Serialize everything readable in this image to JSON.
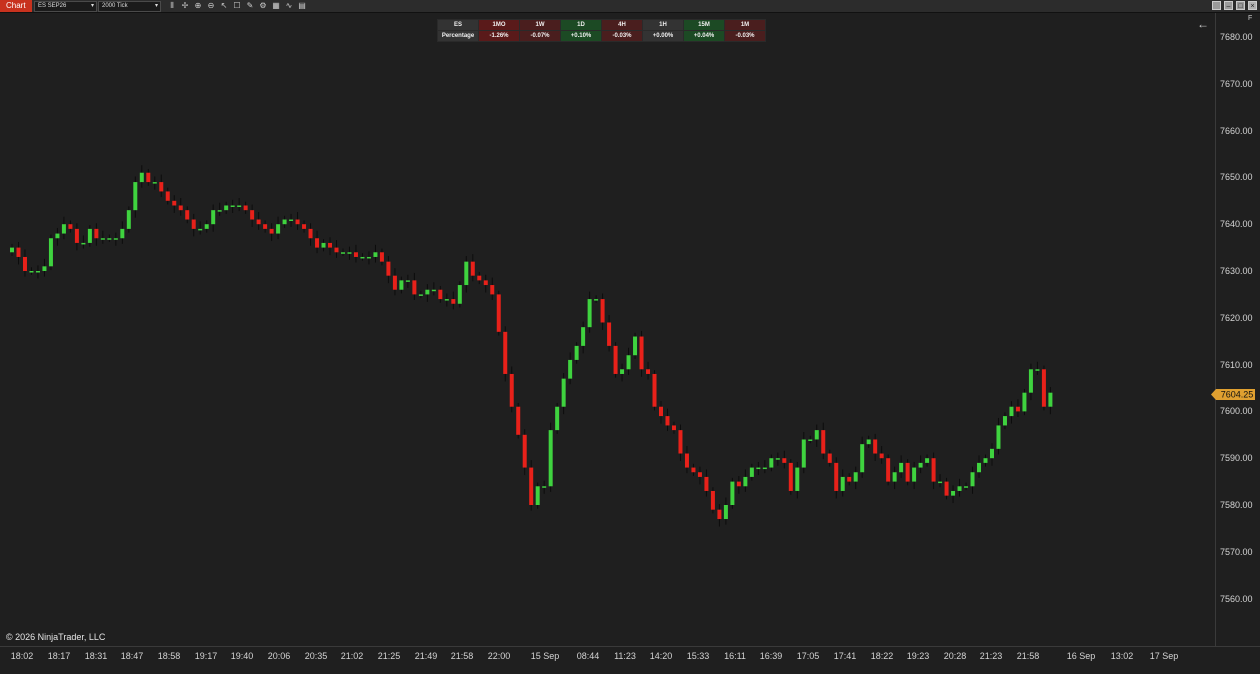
{
  "toolbar": {
    "chart_tab": "Chart",
    "instrument": "ES SEP26",
    "interval": "2000 Tick",
    "icons": [
      "bars-icon",
      "crosshair-icon",
      "zoom-in-icon",
      "zoom-out-icon",
      "pointer-icon",
      "properties-icon",
      "drawing-tools-icon",
      "strategies-icon",
      "data-box-icon",
      "indicators-icon",
      "templates-icon"
    ]
  },
  "performance_table": {
    "symbol": "ES",
    "row_label": "Percentage",
    "columns": [
      {
        "period": "1MO",
        "value": "-1.26%",
        "color": "#5a1a1a"
      },
      {
        "period": "1W",
        "value": "-0.07%",
        "color": "#4a1e1e"
      },
      {
        "period": "1D",
        "value": "+0.10%",
        "color": "#1c4a24"
      },
      {
        "period": "4H",
        "value": "-0.03%",
        "color": "#4a1e1e"
      },
      {
        "period": "1H",
        "value": "+0.00%",
        "color": "#333333"
      },
      {
        "period": "15M",
        "value": "+0.04%",
        "color": "#1c4a24"
      },
      {
        "period": "1M",
        "value": "-0.03%",
        "color": "#4a1e1e"
      }
    ]
  },
  "copyright": "© 2026 NinjaTrader, LLC",
  "axis_menu_label": "F",
  "last_price": "7604.25",
  "colors": {
    "up": "#3fd33f",
    "down": "#e8211a",
    "wick": "#1a1a1a",
    "price_marker": "#e0a030"
  },
  "chart_data": {
    "type": "candlestick",
    "ylim": [
      7555,
      7685
    ],
    "y_ticks": [
      "7680.00",
      "7670.00",
      "7660.00",
      "7650.00",
      "7640.00",
      "7630.00",
      "7620.00",
      "7610.00",
      "7600.00",
      "7590.00",
      "7580.00",
      "7570.00",
      "7560.00"
    ],
    "x_ticks": [
      "18:02",
      "18:17",
      "18:31",
      "18:47",
      "18:58",
      "19:17",
      "19:40",
      "20:06",
      "20:35",
      "21:02",
      "21:25",
      "21:49",
      "21:58",
      "22:00",
      "15 Sep",
      "08:44",
      "11:23",
      "14:20",
      "15:33",
      "16:11",
      "16:39",
      "17:05",
      "17:41",
      "18:22",
      "19:23",
      "20:28",
      "21:23",
      "21:58",
      "16 Sep",
      "13:02",
      "17 Sep"
    ],
    "closes": [
      7635,
      7633,
      7630,
      7630,
      7630,
      7631,
      7637,
      7638,
      7640,
      7639,
      7636,
      7636,
      7639,
      7637,
      7637,
      7637,
      7637,
      7639,
      7643,
      7649,
      7651,
      7649,
      7649,
      7647,
      7645,
      7644,
      7643,
      7641,
      7639,
      7639,
      7640,
      7643,
      7643,
      7644,
      7644,
      7644,
      7643,
      7641,
      7640,
      7639,
      7638,
      7640,
      7641,
      7641,
      7640,
      7639,
      7637,
      7635,
      7636,
      7635,
      7634,
      7634,
      7634,
      7633,
      7633,
      7633,
      7634,
      7632,
      7629,
      7626,
      7628,
      7628,
      7625,
      7625,
      7626,
      7626,
      7624,
      7624,
      7623,
      7627,
      7632,
      7629,
      7628,
      7627,
      7625,
      7617,
      7608,
      7601,
      7595,
      7588,
      7580,
      7584,
      7584,
      7596,
      7601,
      7607,
      7611,
      7614,
      7618,
      7624,
      7624,
      7619,
      7614,
      7608,
      7609,
      7612,
      7616,
      7609,
      7608,
      7601,
      7599,
      7597,
      7596,
      7591,
      7588,
      7587,
      7586,
      7583,
      7579,
      7577,
      7580,
      7585,
      7584,
      7586,
      7588,
      7588,
      7588,
      7590,
      7590,
      7589,
      7583,
      7588,
      7594,
      7594,
      7596,
      7591,
      7589,
      7583,
      7586,
      7585,
      7587,
      7593,
      7594,
      7591,
      7590,
      7585,
      7587,
      7589,
      7585,
      7588,
      7589,
      7590,
      7585,
      7585,
      7582,
      7583,
      7584,
      7584,
      7587,
      7589,
      7590,
      7592,
      7597,
      7599,
      7601,
      7600,
      7604,
      7609,
      7609,
      7601,
      7604
    ]
  }
}
